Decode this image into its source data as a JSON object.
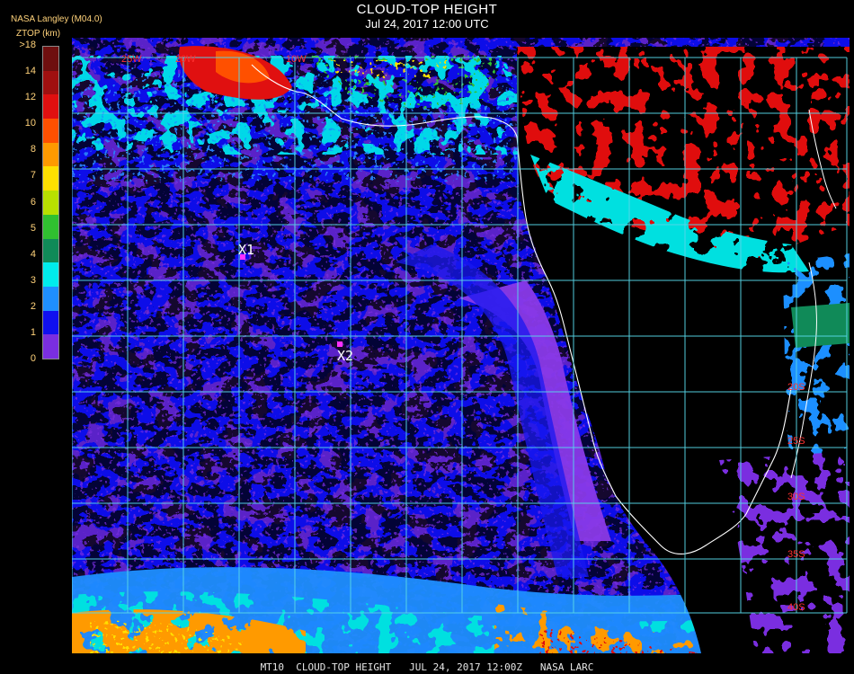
{
  "header": {
    "title": "CLOUD-TOP HEIGHT",
    "subtitle": "Jul 24, 2017 12:00 UTC",
    "source": "NASA Langley (M04.0)",
    "parameter": "ZTOP (km)"
  },
  "legend": {
    "tick_labels": [
      ">18",
      "14",
      "12",
      "10",
      "8",
      "7",
      "6",
      "5",
      "4",
      "3",
      "2",
      "1",
      "0"
    ],
    "colors": [
      "#6e0f0f",
      "#a01010",
      "#e01010",
      "#ff5000",
      "#ff9a00",
      "#ffe000",
      "#b8e000",
      "#30c030",
      "#108a58",
      "#00ecec",
      "#1f8fff",
      "#1010f0",
      "#7a2ee0"
    ]
  },
  "map": {
    "grid_color": "#57d6e8",
    "coast_color": "#ffffff",
    "latitude_labels": [
      "20S",
      "25S",
      "30S",
      "35S",
      "40S"
    ],
    "longitude_labels": [
      "25W",
      "20W",
      "10W"
    ],
    "markers": [
      {
        "label": "X1",
        "lon": -15.5,
        "lat": -8.5
      },
      {
        "label": "X2",
        "lon": -6.5,
        "lat": -16
      }
    ]
  },
  "footer": {
    "text": "MT10  CLOUD-TOP HEIGHT   JUL 24, 2017 12:00Z   NASA LARC"
  }
}
